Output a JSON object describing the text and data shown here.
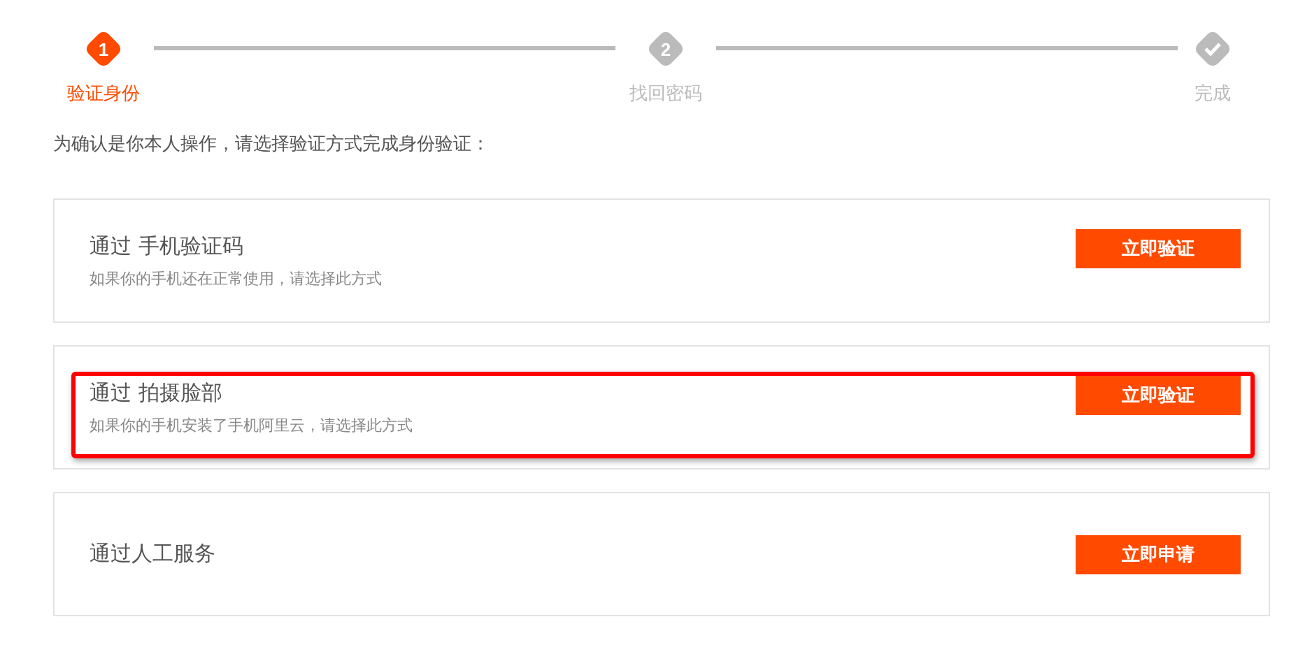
{
  "steps": [
    {
      "kind": "number",
      "marker": "1",
      "label": "验证身份",
      "selected": true
    },
    {
      "kind": "number",
      "marker": "2",
      "label": "找回密码",
      "selected": false
    },
    {
      "kind": "check",
      "label": "完成",
      "selected": false
    }
  ],
  "intro": "为确认是你本人操作，请选择验证方式完成身份验证：",
  "options": [
    {
      "title": "通过 手机验证码",
      "description": "如果你的手机还在正常使用，请选择此方式",
      "button": "立即验证",
      "highlighted": false
    },
    {
      "title": "通过 拍摄脸部",
      "description": "如果你的手机安装了手机阿里云，请选择此方式",
      "button": "立即验证",
      "highlighted": true
    },
    {
      "title": "通过人工服务",
      "button": "立即申请",
      "highlighted": false
    }
  ]
}
